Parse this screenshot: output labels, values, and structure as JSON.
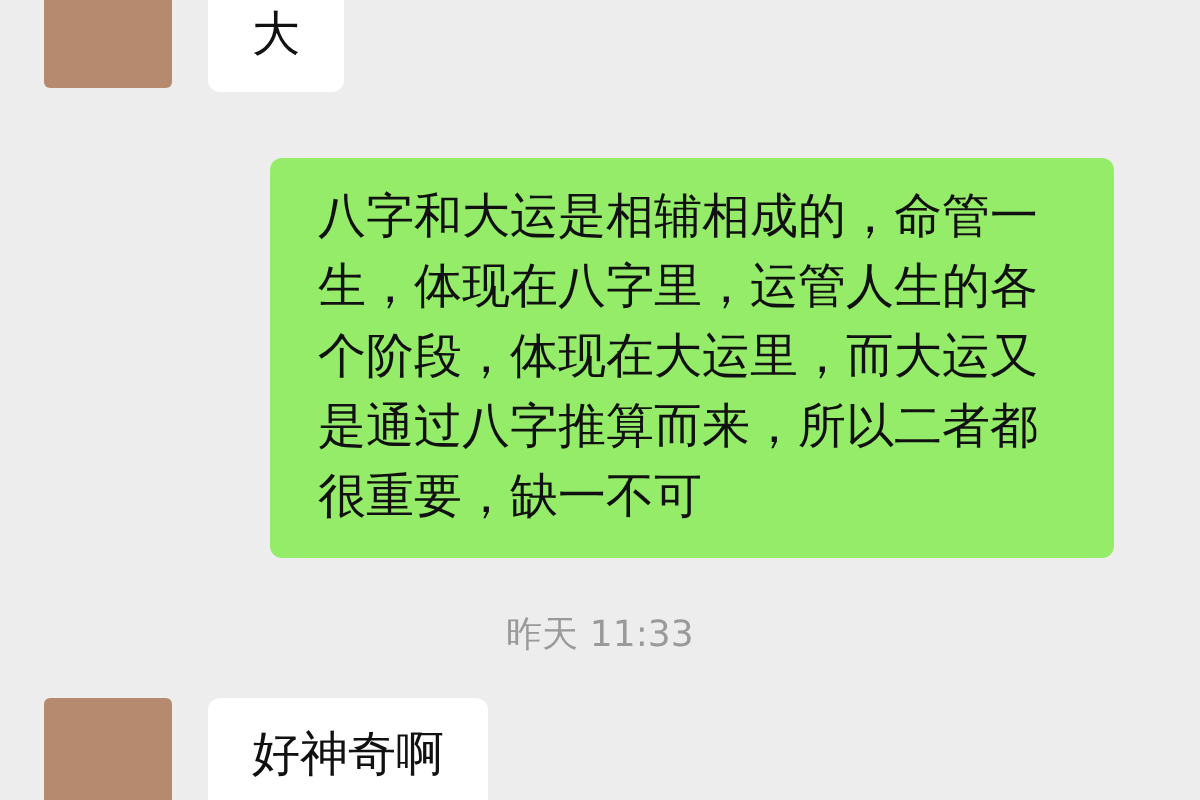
{
  "messages": [
    {
      "kind": "incoming",
      "text": "大"
    },
    {
      "kind": "outgoing",
      "text": "八字和大运是相辅相成的，命管一生，体现在八字里，运管人生的各个阶段，体现在大运里，而大运又是通过八字推算而来，所以二者都很重要，缺一不可"
    },
    {
      "kind": "time",
      "text": "昨天 11:33"
    },
    {
      "kind": "incoming",
      "text": "好神奇啊"
    }
  ]
}
